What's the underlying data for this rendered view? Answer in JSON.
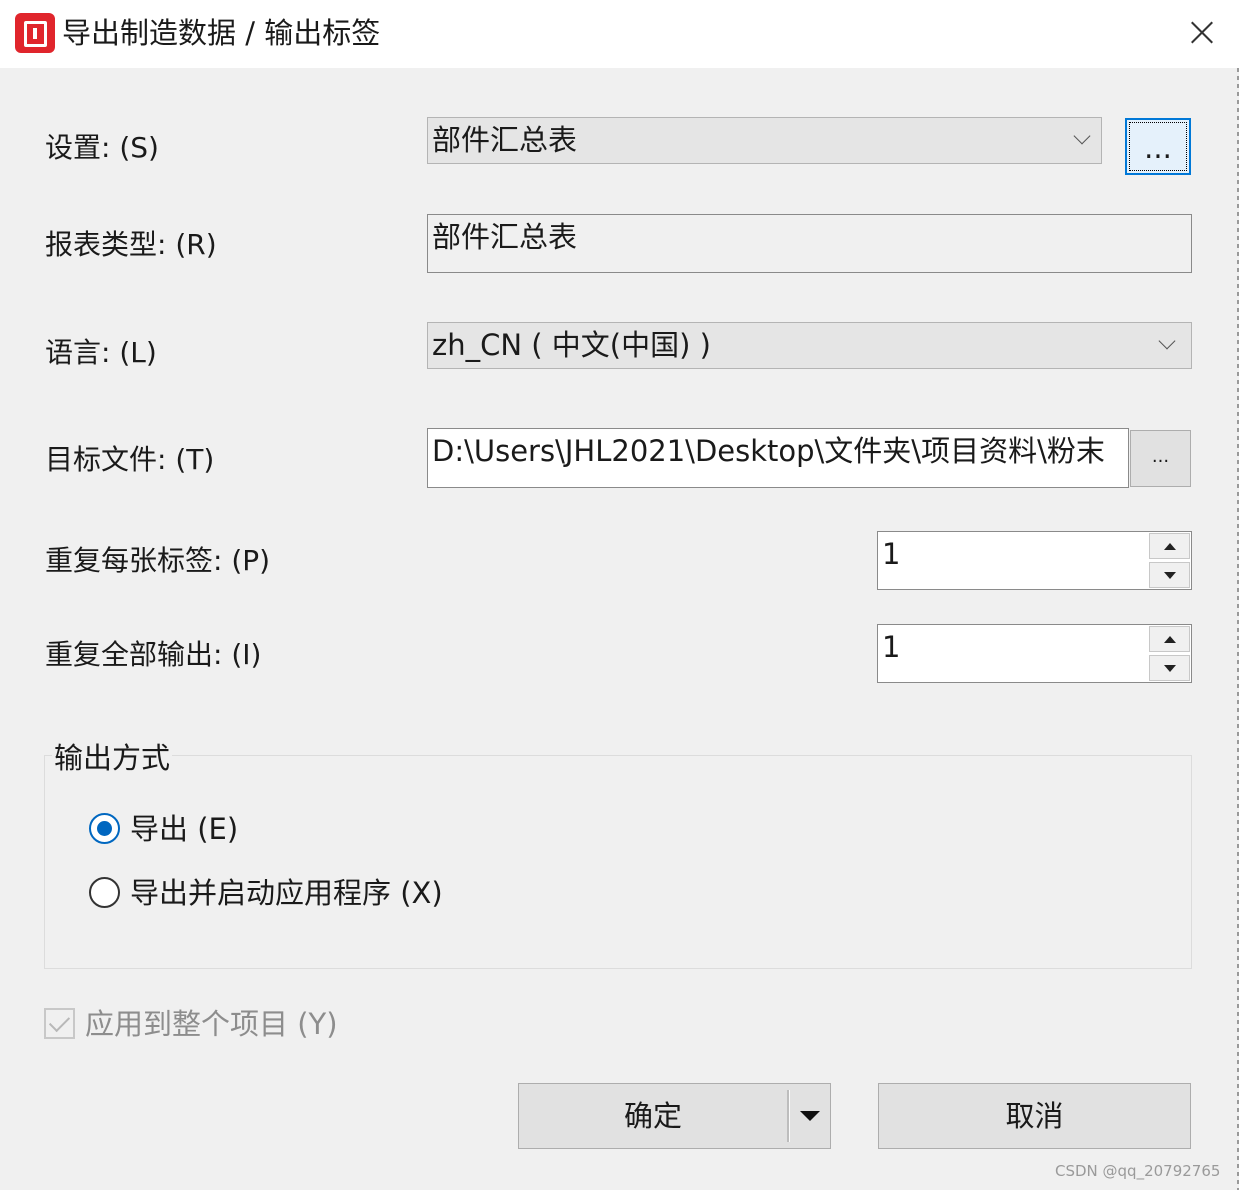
{
  "window": {
    "title": "导出制造数据 / 输出标签",
    "icon": "app-icon"
  },
  "settings": {
    "label": "设置: (S)",
    "value": "部件汇总表",
    "button_label": "..."
  },
  "report_type": {
    "label": "报表类型: (R)",
    "value": "部件汇总表"
  },
  "language": {
    "label": "语言: (L)",
    "value": "zh_CN ( 中文(中国) )"
  },
  "target_file": {
    "label": "目标文件: (T)",
    "value": "D:\\Users\\JHL2021\\Desktop\\文件夹\\项目资料\\粉末",
    "button_label": "..."
  },
  "repeat_each_label": {
    "label": "重复每张标签: (P)",
    "value": "1"
  },
  "repeat_all_output": {
    "label": "重复全部输出: (I)",
    "value": "1"
  },
  "output_mode": {
    "title": "输出方式",
    "options": [
      {
        "label": "导出 (E)",
        "checked": true
      },
      {
        "label": "导出并启动应用程序 (X)",
        "checked": false
      }
    ]
  },
  "apply_project": {
    "label": "应用到整个项目 (Y)",
    "checked": true,
    "disabled": true
  },
  "buttons": {
    "ok": "确定",
    "cancel": "取消"
  },
  "watermark": "CSDN @qq_20792765",
  "colors": {
    "icon_red": "#e0252c",
    "accent": "#0067c0"
  }
}
